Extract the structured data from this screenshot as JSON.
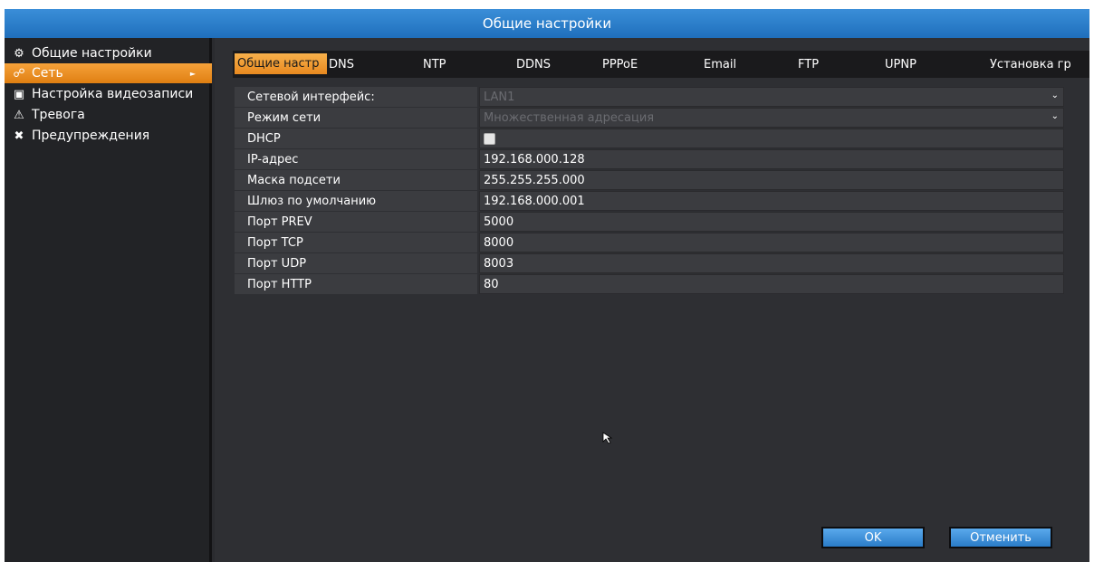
{
  "title": "Общие настройки",
  "sidebar": {
    "items": [
      {
        "label": "Общие настройки",
        "icon": "gears-icon",
        "glyph": "⚙",
        "active": false
      },
      {
        "label": "Сеть",
        "icon": "network-icon",
        "glyph": "☍",
        "active": true
      },
      {
        "label": "Настройка видеозаписи",
        "icon": "film-icon",
        "glyph": "▣",
        "active": false
      },
      {
        "label": "Тревога",
        "icon": "warning-icon",
        "glyph": "⚠",
        "active": false
      },
      {
        "label": "Предупреждения",
        "icon": "tools-icon",
        "glyph": "✖",
        "active": false
      }
    ],
    "arrow": "►"
  },
  "tabs": [
    {
      "label": "Общие настр",
      "active": true
    },
    {
      "label": "DNS"
    },
    {
      "label": "NTP"
    },
    {
      "label": "DDNS"
    },
    {
      "label": "PPPoE"
    },
    {
      "label": "Email"
    },
    {
      "label": "FTP"
    },
    {
      "label": "UPNP"
    },
    {
      "label": "Установка гр"
    }
  ],
  "form": {
    "rows": [
      {
        "label": "Сетевой интерфейс:",
        "value": "LAN1",
        "type": "select",
        "disabled": true
      },
      {
        "label": "Режим сети",
        "value": "Множественная адресация",
        "type": "select",
        "disabled": true
      },
      {
        "label": "DHCP",
        "value": "",
        "type": "checkbox",
        "checked": false
      },
      {
        "label": "IP-адрес",
        "value": "192.168.000.128",
        "type": "text"
      },
      {
        "label": "Маска подсети",
        "value": "255.255.255.000",
        "type": "text"
      },
      {
        "label": "Шлюз по умолчанию",
        "value": "192.168.000.001",
        "type": "text"
      },
      {
        "label": "Порт PREV",
        "value": "5000",
        "type": "text"
      },
      {
        "label": "Порт TCP",
        "value": "8000",
        "type": "text"
      },
      {
        "label": "Порт UDP",
        "value": "8003",
        "type": "text"
      },
      {
        "label": "Порт HTTP",
        "value": "80",
        "type": "text"
      }
    ]
  },
  "buttons": {
    "ok": "OK",
    "cancel": "Отменить"
  },
  "colors": {
    "accent": "#f0952a",
    "title_bar": "#2a7cc8",
    "button": "#3f92dc"
  }
}
